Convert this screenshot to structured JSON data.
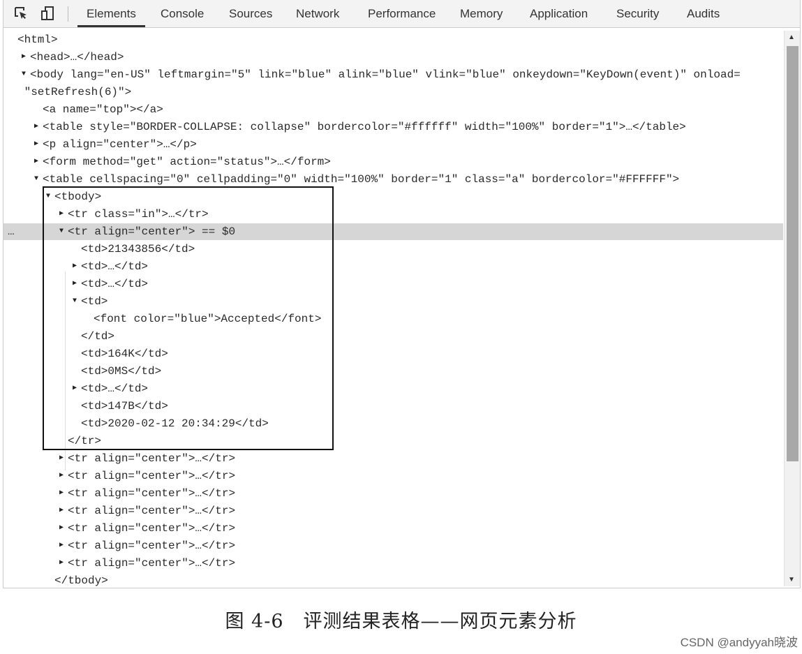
{
  "tabs": [
    {
      "label": "Elements",
      "active": true
    },
    {
      "label": "Console"
    },
    {
      "label": "Sources"
    },
    {
      "label": "Network"
    },
    {
      "label": "Performance"
    },
    {
      "label": "Memory"
    },
    {
      "label": "Application"
    },
    {
      "label": "Security"
    },
    {
      "label": "Audits"
    }
  ],
  "toolbar_icons": [
    "inspect-element-icon",
    "device-toolbar-icon"
  ],
  "dom_tree": [
    {
      "indent": 0,
      "toggle": "none",
      "text": "<html>"
    },
    {
      "indent": 1,
      "toggle": "collapsed",
      "text": "<head>…</head>"
    },
    {
      "indent": 1,
      "toggle": "expanded",
      "text": "<body lang=\"en-US\" leftmargin=\"5\" link=\"blue\" alink=\"blue\" vlink=\"blue\" onkeydown=\"KeyDown(event)\" onload="
    },
    {
      "indent": 0,
      "toggle": "none",
      "text": " \"setRefresh(6)\">"
    },
    {
      "indent": 2,
      "toggle": "none",
      "text": "<a name=\"top\"></a>"
    },
    {
      "indent": 2,
      "toggle": "collapsed",
      "text": "<table style=\"BORDER-COLLAPSE: collapse\" bordercolor=\"#ffffff\" width=\"100%\" border=\"1\">…</table>"
    },
    {
      "indent": 2,
      "toggle": "collapsed",
      "text": "<p align=\"center\">…</p>"
    },
    {
      "indent": 2,
      "toggle": "collapsed",
      "text": "<form method=\"get\" action=\"status\">…</form>"
    },
    {
      "indent": 2,
      "toggle": "expanded",
      "text": "<table cellspacing=\"0\" cellpadding=\"0\" width=\"100%\" border=\"1\" class=\"a\" bordercolor=\"#FFFFFF\">"
    },
    {
      "indent": 3,
      "toggle": "expanded",
      "text": "<tbody>"
    },
    {
      "indent": 4,
      "toggle": "collapsed",
      "text": "<tr class=\"in\">…</tr>"
    },
    {
      "indent": 4,
      "toggle": "expanded",
      "text": "<tr align=\"center\"> == $0",
      "selected": true
    },
    {
      "indent": 5,
      "toggle": "none",
      "text": "<td>21343856</td>"
    },
    {
      "indent": 5,
      "toggle": "collapsed",
      "text": "<td>…</td>"
    },
    {
      "indent": 5,
      "toggle": "collapsed",
      "text": "<td>…</td>"
    },
    {
      "indent": 5,
      "toggle": "expanded",
      "text": "<td>"
    },
    {
      "indent": 6,
      "toggle": "none",
      "text": "<font color=\"blue\">Accepted</font>"
    },
    {
      "indent": 5,
      "toggle": "none",
      "text": "</td>"
    },
    {
      "indent": 5,
      "toggle": "none",
      "text": "<td>164K</td>"
    },
    {
      "indent": 5,
      "toggle": "none",
      "text": "<td>0MS</td>"
    },
    {
      "indent": 5,
      "toggle": "collapsed",
      "text": "<td>…</td>"
    },
    {
      "indent": 5,
      "toggle": "none",
      "text": "<td>147B</td>"
    },
    {
      "indent": 5,
      "toggle": "none",
      "text": "<td>2020-02-12 20:34:29</td>"
    },
    {
      "indent": 4,
      "toggle": "none",
      "text": "</tr>"
    },
    {
      "indent": 4,
      "toggle": "collapsed",
      "text": "<tr align=\"center\">…</tr>"
    },
    {
      "indent": 4,
      "toggle": "collapsed",
      "text": "<tr align=\"center\">…</tr>"
    },
    {
      "indent": 4,
      "toggle": "collapsed",
      "text": "<tr align=\"center\">…</tr>"
    },
    {
      "indent": 4,
      "toggle": "collapsed",
      "text": "<tr align=\"center\">…</tr>"
    },
    {
      "indent": 4,
      "toggle": "collapsed",
      "text": "<tr align=\"center\">…</tr>"
    },
    {
      "indent": 4,
      "toggle": "collapsed",
      "text": "<tr align=\"center\">…</tr>"
    },
    {
      "indent": 4,
      "toggle": "collapsed",
      "text": "<tr align=\"center\">…</tr>"
    },
    {
      "indent": 3,
      "toggle": "none",
      "text": "</tbody>"
    }
  ],
  "selected_dots": "…",
  "caption": "图 4-6　评测结果表格——网页元素分析",
  "watermark": "CSDN @andyyah晓波"
}
